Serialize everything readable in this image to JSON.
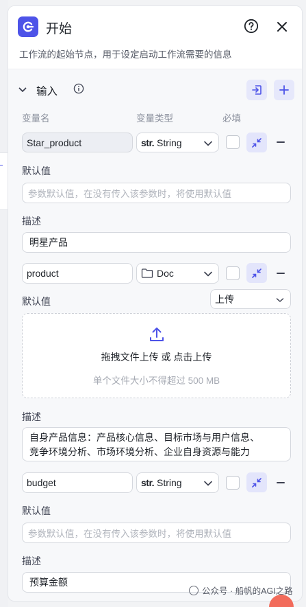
{
  "colors": {
    "accent": "#4d53e8",
    "accent_soft": "#e6e8fb",
    "placeholder": "#b1b5bd"
  },
  "header": {
    "title": "开始",
    "subtitle": "工作流的起始节点，用于设定启动工作流需要的信息",
    "logo_icon": "start-node-icon",
    "help_icon": "question-circle-icon",
    "close_icon": "close-icon"
  },
  "input_section": {
    "title": "输入",
    "columns": {
      "name": "变量名",
      "type": "变量类型",
      "required": "必填"
    },
    "labels": {
      "default": "默认值",
      "description": "描述"
    },
    "default_placeholder": "参数默认值，在没有传入该参数时，将使用默认值",
    "variables": [
      {
        "name": "Star_product",
        "type_prefix": "str.",
        "type": "String",
        "required": false,
        "description": "明星产品"
      },
      {
        "name": "product",
        "type_prefix": "",
        "type": "Doc",
        "required": false,
        "upload_mode": "上传",
        "upload_text": "拖拽文件上传 或 点击上传",
        "upload_hint": "单个文件大小不得超过 500 MB",
        "description_line1": "自身产品信息：产品核心信息、目标市场与用户信息、",
        "description_line2": "竞争环境分析、市场环境分析、企业自身资源与能力"
      },
      {
        "name": "budget",
        "type_prefix": "str.",
        "type": "String",
        "required": false,
        "description": "预算金额"
      }
    ]
  },
  "watermark": {
    "text": "公众号 · 船帆的AGI之路"
  }
}
